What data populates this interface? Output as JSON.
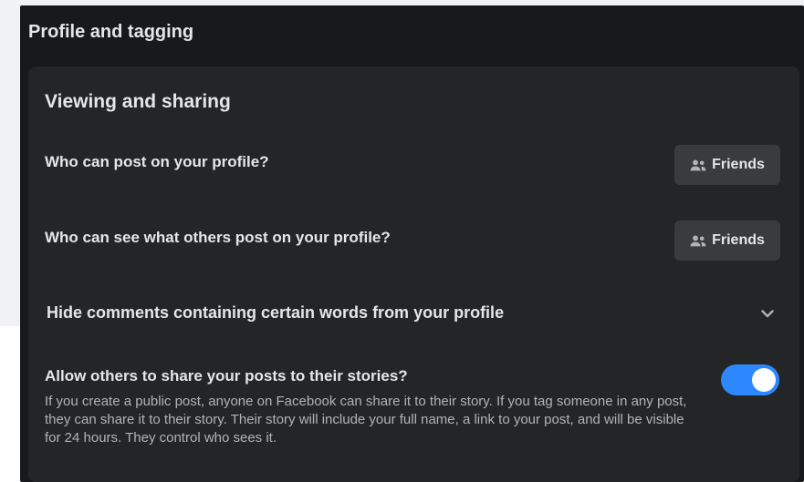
{
  "section": {
    "title": "Profile and tagging"
  },
  "card": {
    "title": "Viewing and sharing",
    "rows": [
      {
        "label": "Who can post on your profile?",
        "audience": "Friends",
        "icon": "friends-icon"
      },
      {
        "label": "Who can see what others post on your profile?",
        "audience": "Friends",
        "icon": "friends-icon"
      },
      {
        "label": "Hide comments containing certain words from your profile",
        "icon": "chevron-down-icon"
      }
    ],
    "stories": {
      "label": "Allow others to share your posts to their stories?",
      "description": "If you create a public post, anyone on Facebook can share it to their story. If you tag someone in any post, they can share it to their story. Their story will include your full name, a link to your post, and will be visible for 24 hours. They control who sees it.",
      "enabled": true
    }
  },
  "colors": {
    "panel": "#18191a",
    "card": "#242526",
    "button": "#3a3b3c",
    "accent": "#2d88ff",
    "text_primary": "#e4e6eb",
    "text_secondary": "#b0b3b8"
  }
}
